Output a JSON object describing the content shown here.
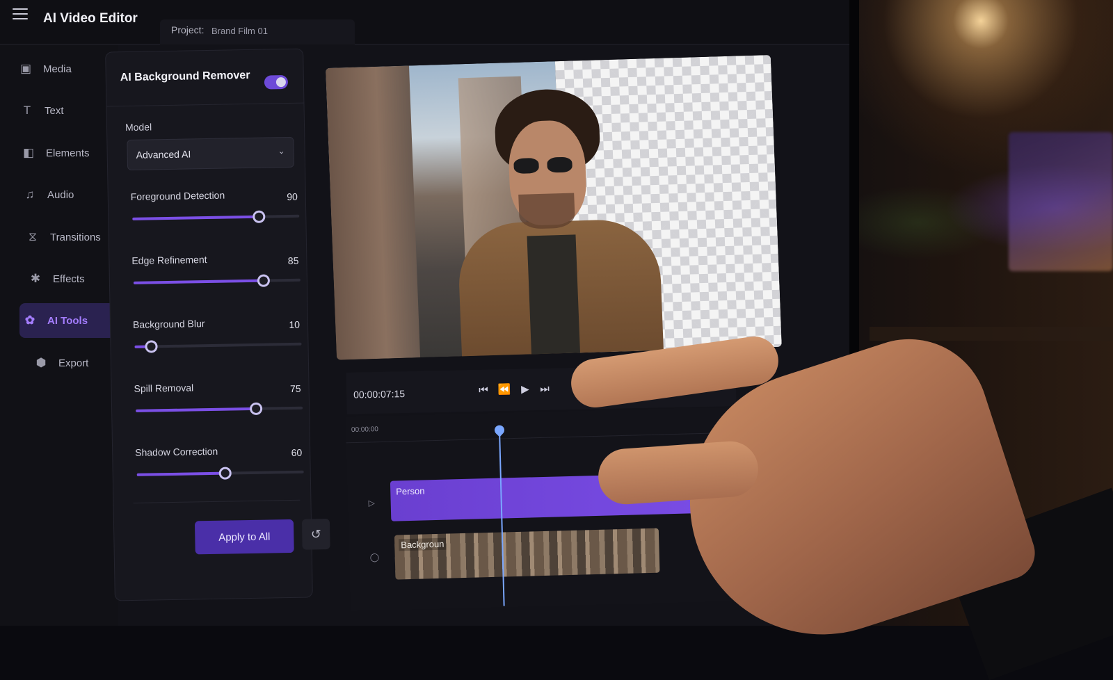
{
  "app": {
    "title": "AI Video Editor"
  },
  "project": {
    "label": "Project:",
    "name": "Brand Film 01"
  },
  "sidebar": {
    "items": [
      {
        "label": "Media",
        "icon": "folder-icon",
        "active": false
      },
      {
        "label": "Text",
        "icon": "text-icon",
        "active": false
      },
      {
        "label": "Elements",
        "icon": "shapes-icon",
        "active": false
      },
      {
        "label": "Audio",
        "icon": "music-note-icon",
        "active": false
      },
      {
        "label": "Transitions",
        "icon": "transition-icon",
        "active": false
      },
      {
        "label": "Effects",
        "icon": "sparkle-icon",
        "active": false
      },
      {
        "label": "AI Tools",
        "icon": "ai-wand-icon",
        "active": true
      },
      {
        "label": "Export",
        "icon": "export-icon",
        "active": false
      }
    ]
  },
  "panel": {
    "title": "AI Background Remover",
    "enabled": true,
    "model_label": "Model",
    "model_value": "Advanced AI",
    "sliders": [
      {
        "label": "Foreground Detection",
        "value": "90",
        "level": 0.76
      },
      {
        "label": "Edge Refinement",
        "value": "85",
        "level": 0.78
      },
      {
        "label": "Background Blur",
        "value": "10",
        "level": 0.1
      },
      {
        "label": "Spill Removal",
        "value": "75",
        "level": 0.72
      },
      {
        "label": "Shadow Correction",
        "value": "60",
        "level": 0.53
      }
    ],
    "apply_label": "Apply to All"
  },
  "transport": {
    "timecode": "00:00:07:15"
  },
  "timeline": {
    "ruler_start": "00:00:00",
    "tracks": [
      {
        "label": "Person",
        "icon": "play-icon"
      },
      {
        "label": "Backgroun",
        "icon": "circle-icon"
      }
    ]
  },
  "colors": {
    "accent": "#7b4fe6",
    "toggle": "#6d4ad8",
    "playhead": "#7aa7ff"
  }
}
